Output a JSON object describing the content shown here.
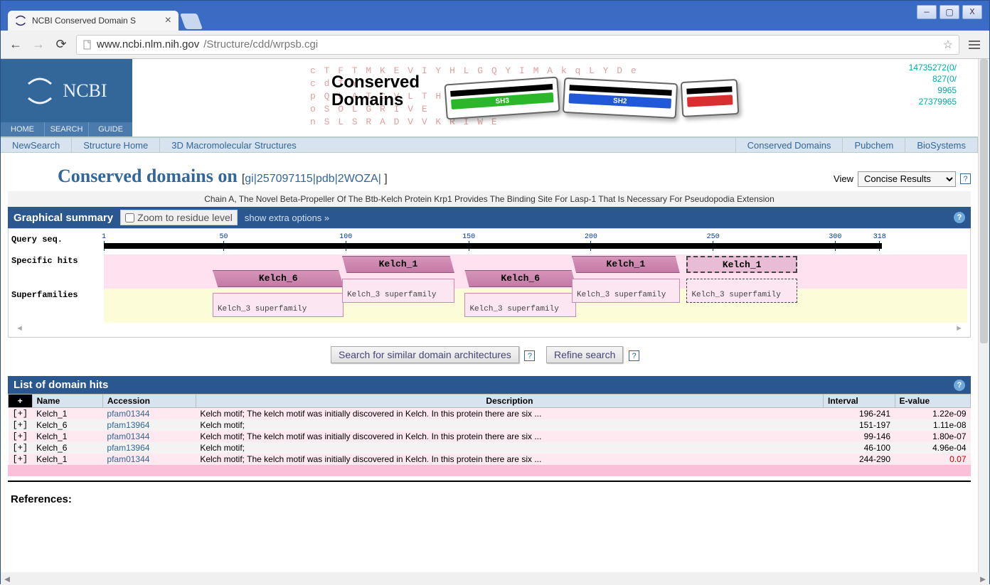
{
  "window": {
    "tab_title": "NCBI Conserved Domain S",
    "url_domain": "www.ncbi.nlm.nih.gov",
    "url_path": "/Structure/cdd/wrpsb.cgi"
  },
  "ncbi": {
    "logo_text": "NCBI",
    "sublinks": [
      "HOME",
      "SEARCH",
      "GUIDE"
    ],
    "banner_title_l1": "Conserved",
    "banner_title_l2": "Domains",
    "puzzle1": "SH3",
    "puzzle2": "SH2"
  },
  "topnav": [
    "NewSearch",
    "Structure Home",
    "3D Macromolecular Structures",
    "Conserved Domains",
    "Pubchem",
    "BioSystems"
  ],
  "title": {
    "main": "Conserved domains on",
    "gi_pre": "[",
    "gi_link": "gi|257097115|pdb|2WOZA|",
    "gi_post": " ]",
    "view_label": "View",
    "view_select": "Concise Results"
  },
  "chain_desc": "Chain A, The Novel Beta-Propeller Of The Btb-Kelch Protein Krp1 Provides The Binding Site For Lasp-1 That Is Necessary For Pseudopodia Extension",
  "graph": {
    "bar_title": "Graphical summary",
    "zoom_label": "Zoom to residue level",
    "extra_label": "show extra options »",
    "row_query": "Query seq.",
    "row_specific": "Specific hits",
    "row_super": "Superfamilies",
    "ruler": [
      "1",
      "50",
      "100",
      "150",
      "200",
      "250",
      "300",
      "318"
    ],
    "d1": "Kelch_6",
    "d2": "Kelch_1",
    "d3": "Kelch_6",
    "d4": "Kelch_1",
    "d5": "Kelch_1",
    "sf": "Kelch_3 superfamily"
  },
  "buttons": {
    "similar": "Search for similar domain architectures",
    "refine": "Refine search"
  },
  "hits": {
    "bar_title": "List of domain hits",
    "headers": {
      "name": "Name",
      "acc": "Accession",
      "desc": "Description",
      "interval": "Interval",
      "evalue": "E-value"
    },
    "rows": [
      {
        "name": "Kelch_1",
        "acc": "pfam01344",
        "desc": "Kelch motif; The kelch motif was initially discovered in Kelch. In this protein there are six ...",
        "interval": "196-241",
        "evalue": "1.22e-09",
        "odd": true
      },
      {
        "name": "Kelch_6",
        "acc": "pfam13964",
        "desc": "Kelch motif;",
        "interval": "151-197",
        "evalue": "1.11e-08",
        "odd": false
      },
      {
        "name": "Kelch_1",
        "acc": "pfam01344",
        "desc": "Kelch motif; The kelch motif was initially discovered in Kelch. In this protein there are six ...",
        "interval": "99-146",
        "evalue": "1.80e-07",
        "odd": true
      },
      {
        "name": "Kelch_6",
        "acc": "pfam13964",
        "desc": "Kelch motif;",
        "interval": "46-100",
        "evalue": "4.96e-04",
        "odd": false
      },
      {
        "name": "Kelch_1",
        "acc": "pfam01344",
        "desc": "Kelch motif; The kelch motif was initially discovered in Kelch. In this protein there are six ...",
        "interval": "244-290",
        "evalue": "0.07",
        "odd": true,
        "red": true
      }
    ]
  },
  "references_head": "References:"
}
